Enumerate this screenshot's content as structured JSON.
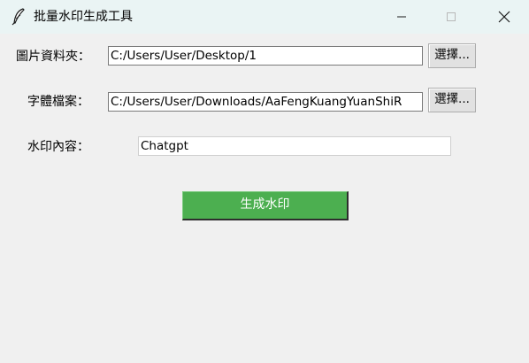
{
  "window": {
    "title": "批量水印生成工具",
    "icon": "feather-icon",
    "controls": [
      "minimize-icon",
      "maximize-icon",
      "close-icon"
    ]
  },
  "form": {
    "image_folder": {
      "label": "圖片資料夾：",
      "value": "C:/Users/User/Desktop/1",
      "button_label": "選擇..."
    },
    "font_file": {
      "label": "字體檔案：",
      "value": "C:/Users/User/Downloads/AaFengKuangYuanShiR",
      "button_label": "選擇..."
    },
    "watermark_text": {
      "label": "水印內容：",
      "value": "Chatgpt"
    },
    "generate_button_label": "生成水印"
  },
  "colors": {
    "titlebar": "#eaf4f4",
    "window_bg": "#f0f0f0",
    "generate_button_bg": "#4caf50",
    "generate_button_text": "#ffffff"
  }
}
